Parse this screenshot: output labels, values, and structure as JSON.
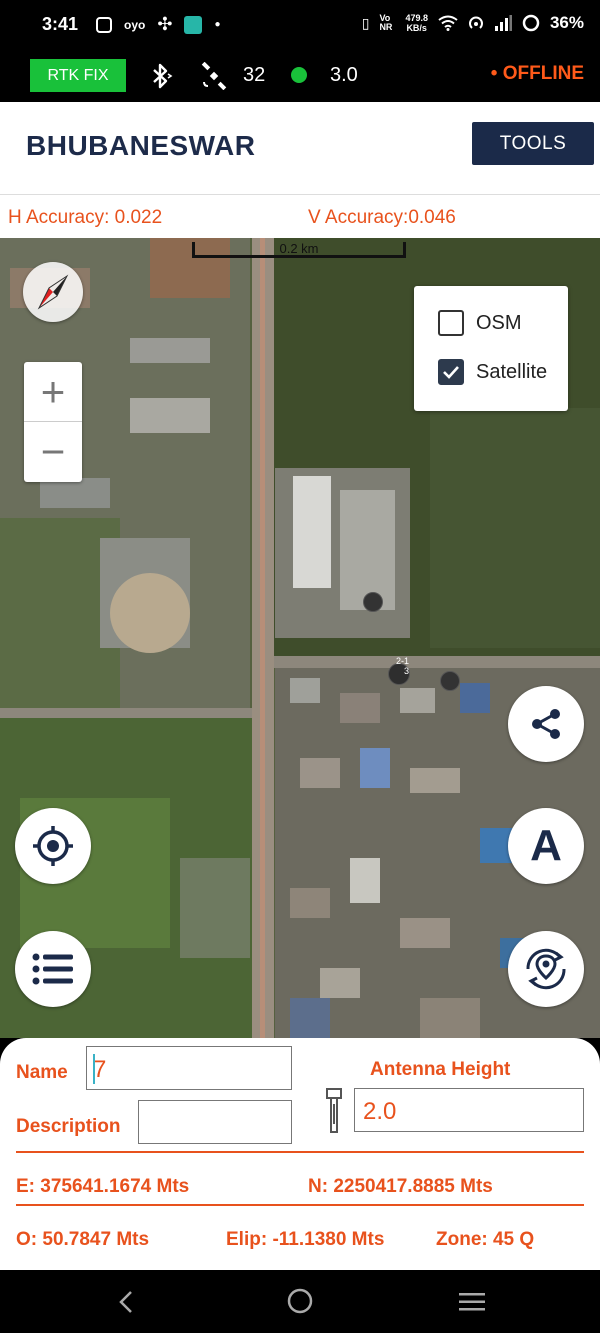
{
  "status_bar": {
    "time": "3:41",
    "speed": "479.8",
    "speed_unit": "KB/s",
    "network": "Vo NR",
    "battery": "36%",
    "icons": [
      "instagram-icon",
      "oyo-icon",
      "fan-icon",
      "app-icon",
      "dot-icon",
      "vibrate-icon",
      "wifi-icon",
      "hotspot-icon",
      "signal-icon",
      "battery-icon"
    ]
  },
  "gps_bar": {
    "fix_status": "RTK FIX",
    "satellites": "32",
    "hdop": "3.0",
    "connection": "• OFFLINE",
    "colors": {
      "fix": "#19c13a",
      "offline": "#ff5a1a",
      "dot": "#19c13a"
    }
  },
  "header": {
    "title": "BHUBANESWAR",
    "tools_label": "TOOLS"
  },
  "accuracy": {
    "h_label": "H Accuracy: 0.022",
    "v_label": "V Accuracy:0.046"
  },
  "map": {
    "scale_label": "0.2 km",
    "zoom_in": "+",
    "zoom_out": "−",
    "layers": [
      {
        "label": "OSM",
        "checked": false
      },
      {
        "label": "Satellite",
        "checked": true
      }
    ],
    "marker_labels": [
      "2-1",
      "3"
    ],
    "auto_button": "A"
  },
  "form": {
    "name_label": "Name",
    "name_value": "7",
    "description_label": "Description",
    "description_value": "",
    "antenna_label": "Antenna Height",
    "antenna_value": "2.0",
    "easting": "E: 375641.1674 Mts",
    "northing": "N: 2250417.8885 Mts",
    "ortho": "O: 50.7847 Mts",
    "ellip": "Elip: -11.1380 Mts",
    "zone": "Zone: 45 Q"
  },
  "accent_color": "#e8521d",
  "brand_color": "#1b2a49"
}
